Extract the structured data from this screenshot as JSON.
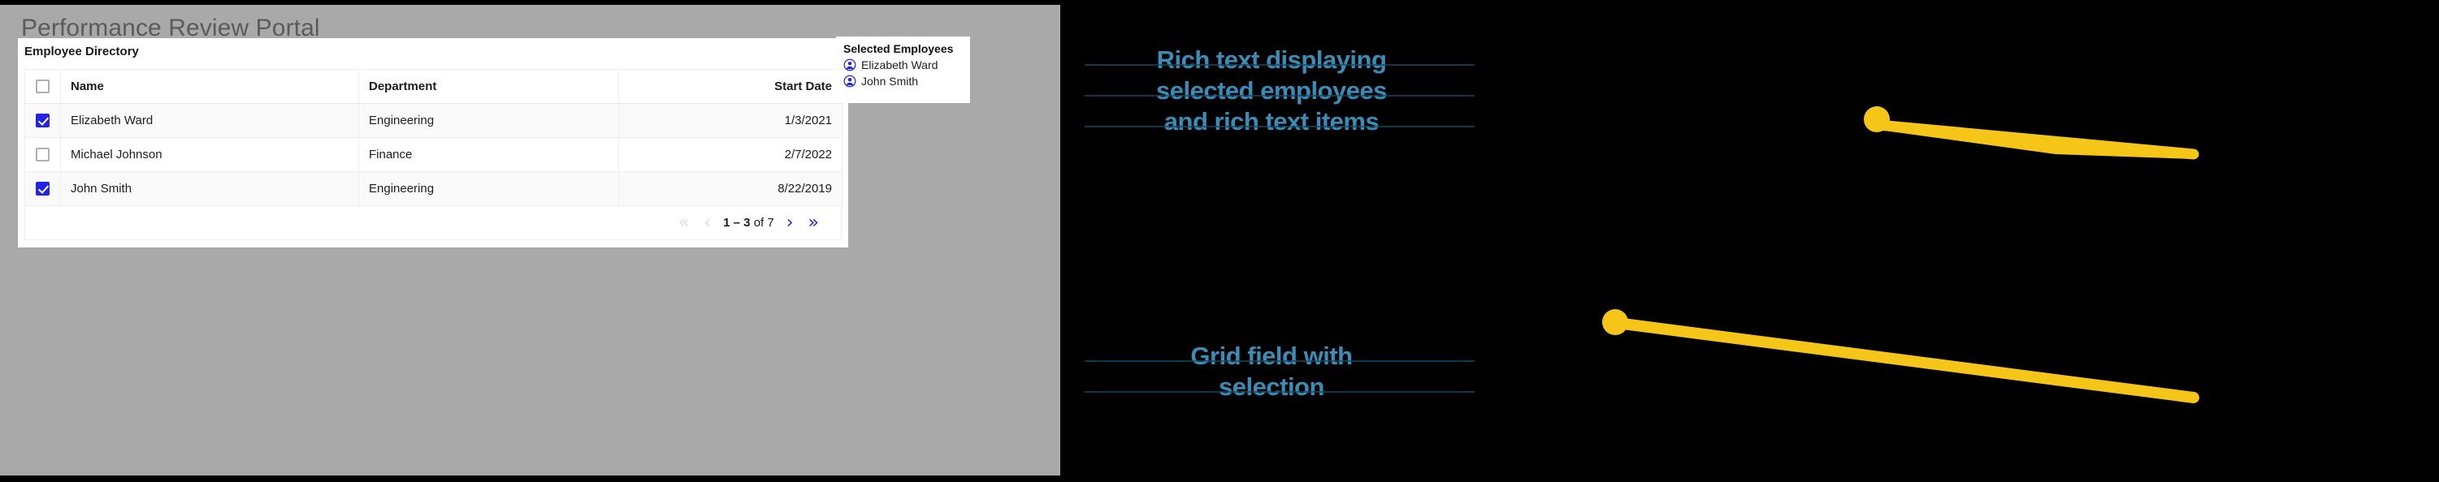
{
  "app": {
    "title": "Performance Review Portal",
    "surface_color": "#a9a9a9",
    "accent_color": "#2323e8",
    "callout_color": "#f5c518"
  },
  "grid_card": {
    "title": "Employee Directory",
    "columns": [
      {
        "key": "select",
        "label": "",
        "align": "center"
      },
      {
        "key": "name",
        "label": "Name",
        "align": "left"
      },
      {
        "key": "department",
        "label": "Department",
        "align": "left"
      },
      {
        "key": "start_date",
        "label": "Start Date",
        "align": "right"
      }
    ],
    "header_select_all": {
      "icon": "checkbox-unchecked-icon",
      "checked": false
    },
    "rows": [
      {
        "checked": true,
        "name": "Elizabeth Ward",
        "department": "Engineering",
        "start_date": "1/3/2021"
      },
      {
        "checked": false,
        "name": "Michael Johnson",
        "department": "Finance",
        "start_date": "2/7/2022"
      },
      {
        "checked": true,
        "name": "John Smith",
        "department": "Engineering",
        "start_date": "8/22/2019"
      }
    ],
    "pagination": {
      "first_icon": "double-chevron-left-icon",
      "prev_icon": "chevron-left-icon",
      "next_icon": "chevron-right-icon",
      "last_icon": "double-chevron-right-icon",
      "first_glyph": "«",
      "prev_glyph": "‹",
      "next_glyph": "›",
      "last_glyph": "»",
      "range": "1 – 3",
      "of_label": "of",
      "total": "7",
      "first_enabled": false,
      "prev_enabled": false,
      "next_enabled": true,
      "last_enabled": true
    }
  },
  "selected_panel": {
    "title": "Selected Employees",
    "items": [
      {
        "icon": "account-circle-icon",
        "label": "Elizabeth Ward"
      },
      {
        "icon": "account-circle-icon",
        "label": "John Smith"
      }
    ]
  },
  "annotations": {
    "top": {
      "lines": [
        "Rich text displaying",
        "selected employees",
        "and rich text items"
      ]
    },
    "bottom": {
      "lines": [
        "Grid field with",
        "selection"
      ]
    }
  }
}
